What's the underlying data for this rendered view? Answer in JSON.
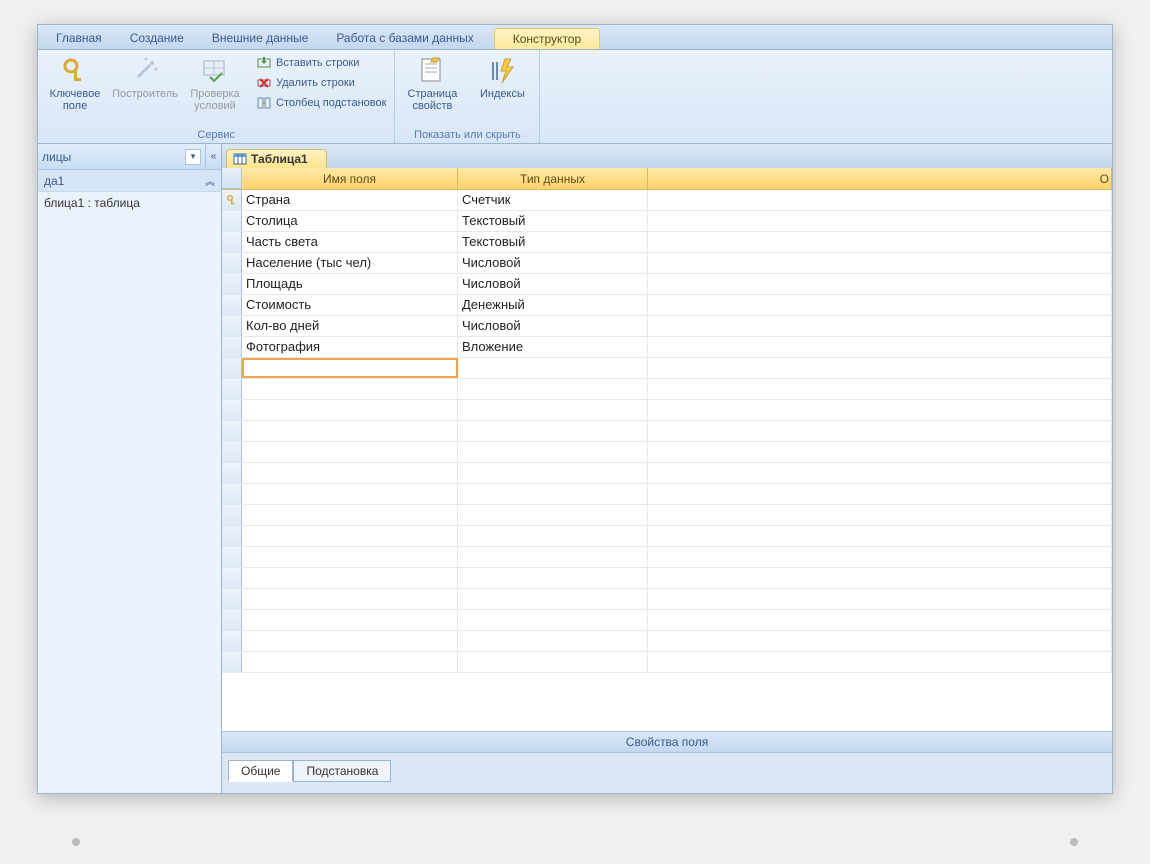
{
  "tabs": {
    "home": "Главная",
    "create": "Создание",
    "external": "Внешние данные",
    "dbtools": "Работа с базами данных",
    "design": "Конструктор"
  },
  "ribbon": {
    "keyfield": "Ключевое поле",
    "builder": "Построитель",
    "validate": "Проверка условий",
    "insert_rows": "Вставить строки",
    "delete_rows": "Удалить строки",
    "lookup_col": "Столбец подстановок",
    "group_tools": "Сервис",
    "prop_sheet": "Страница свойств",
    "indexes": "Индексы",
    "group_showhide": "Показать или скрыть"
  },
  "nav": {
    "category": "лицы",
    "group": "да1",
    "item": "блица1 : таблица"
  },
  "doc_tab": "Таблица1",
  "columns": {
    "name": "Имя поля",
    "type": "Тип данных",
    "desc": "О"
  },
  "fields": [
    {
      "key": true,
      "name": "Страна",
      "type": "Счетчик"
    },
    {
      "key": false,
      "name": "Столица",
      "type": "Текстовый"
    },
    {
      "key": false,
      "name": "Часть света",
      "type": "Текстовый"
    },
    {
      "key": false,
      "name": "Население (тыс чел)",
      "type": "Числовой"
    },
    {
      "key": false,
      "name": "Площадь",
      "type": "Числовой"
    },
    {
      "key": false,
      "name": "Стоимость",
      "type": "Денежный"
    },
    {
      "key": false,
      "name": "Кол-во дней",
      "type": "Числовой"
    },
    {
      "key": false,
      "name": "Фотография",
      "type": "Вложение"
    }
  ],
  "props_label": "Свойства поля",
  "prop_tabs": {
    "general": "Общие",
    "lookup": "Подстановка"
  }
}
